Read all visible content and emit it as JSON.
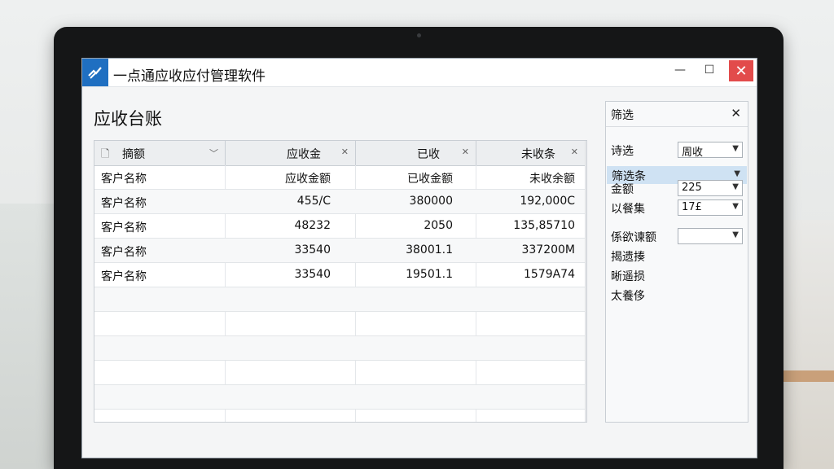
{
  "window": {
    "title": "一点通应收应付管理软件"
  },
  "page": {
    "title": "应收台账"
  },
  "table": {
    "columns": [
      "摘额",
      "应收金",
      "已收",
      "未收条"
    ],
    "rows": [
      [
        "客户名称",
        "应收金额",
        "已收金额",
        "未收余额"
      ],
      [
        "客户名称",
        "455/C",
        "380000",
        "192,000C"
      ],
      [
        "客户名称",
        "48232",
        "2050",
        "135,85710"
      ],
      [
        "客户名称",
        "33540",
        "38001.1",
        "337200M"
      ],
      [
        "客户名称",
        "33540",
        "19501.1",
        "1579A74"
      ]
    ]
  },
  "filter": {
    "title": "筛选",
    "fields": [
      {
        "label": "诗选",
        "value": "周收"
      },
      {
        "label": "筛选条",
        "value": ""
      },
      {
        "label": "金额",
        "value": "225"
      },
      {
        "label": "以餐集",
        "value": "17£"
      },
      {
        "label": "係欲谏额",
        "value": ""
      }
    ],
    "extra_labels": [
      "揭遗揍",
      "晰遥损",
      "太養侈"
    ]
  }
}
